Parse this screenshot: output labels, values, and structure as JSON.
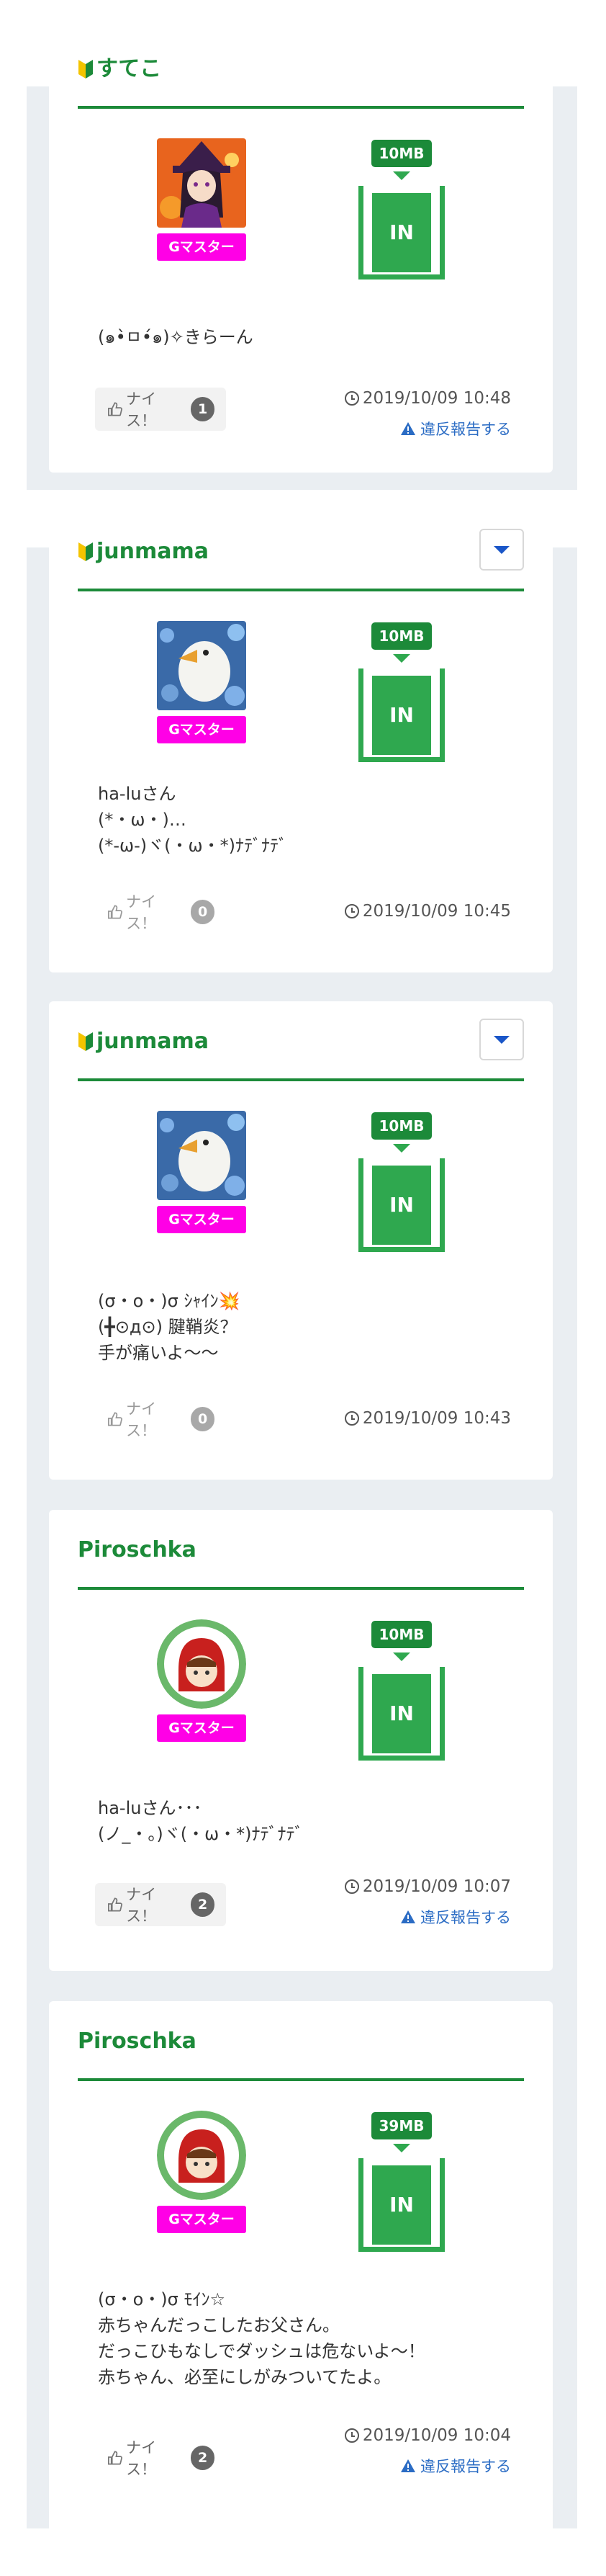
{
  "common": {
    "g_badge": "Gマスター",
    "in_label": "IN",
    "nice_label": "ナイス！",
    "report_label": "違反報告する"
  },
  "posts": [
    {
      "user": "すてこ",
      "beginner": true,
      "size": "10MB",
      "text": "(๑•̀ㅁ•́๑)✧きらーん",
      "likes": "1",
      "time": "2019/10/09 10:48",
      "report": true
    },
    {
      "user": "junmama",
      "beginner": true,
      "menu": true,
      "size": "10MB",
      "text": "ha-luさん\n(*・ω・)…\n(*-ω-)ヾ(・ω・*)ﾅﾃﾞﾅﾃﾞ",
      "likes": "0",
      "time": "2019/10/09 10:45"
    },
    {
      "user": "junmama",
      "beginner": true,
      "menu": true,
      "size": "10MB",
      "text": "(σ・ο・)σ ｼｬｲﾝ💥\n(╋⊙д⊙) 腱鞘炎？\n手が痛いよ〜〜",
      "likes": "0",
      "time": "2019/10/09 10:43"
    },
    {
      "user": "Piroschka",
      "size": "10MB",
      "text": "ha-luさん･･･\n(ノ_・。)ヾ(・ω・*)ﾅﾃﾞﾅﾃﾞ",
      "likes": "2",
      "time": "2019/10/09 10:07",
      "report": true
    },
    {
      "user": "Piroschka",
      "size": "39MB",
      "text": "(σ・ο・)σ ﾓｲﾝ☆\n赤ちゃんだっこしたお父さん。\nだっこひもなしでダッシュは危ないよ〜！\n赤ちゃん、必至にしがみついてたよ。",
      "likes": "2",
      "time": "2019/10/09 10:04",
      "report": true
    }
  ],
  "colors": {
    "accent_green": "#1c8a39",
    "in_green": "#2fa84f",
    "g_badge_magenta": "#ff00e6",
    "link_blue": "#2b6cc4",
    "page_strip": "#eaeef2"
  },
  "icons": [
    "beginner-mark-icon",
    "chevron-down-icon",
    "thumbs-up-icon",
    "clock-icon",
    "warning-icon"
  ]
}
